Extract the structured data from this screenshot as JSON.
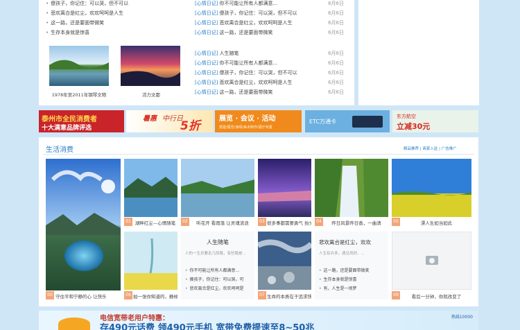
{
  "top_left_list": [
    "傻孩子，你记住：可以哭，但不可以",
    "悲欢离合是红尘，欢欢呵呵是人生",
    "这一路，还是要面带微笑",
    "生存本身就是惊喜"
  ],
  "top_thumbs": [
    {
      "caption": "1978年至2011年钢琴文物"
    },
    {
      "caption": "活力文都"
    }
  ],
  "news": [
    {
      "cat": "[心情日记]",
      "title": "你不可能让所有人都满意...",
      "date": "6月6日"
    },
    {
      "cat": "[心情日记]",
      "title": "傻孩子，你记住：可以哭，但不可以",
      "date": "6月6日"
    },
    {
      "cat": "[心情日记]",
      "title": "悲欢离合是红尘，欢欢呵呵是人生",
      "date": "6月6日"
    },
    {
      "cat": "[心情日记]",
      "title": "这一路，还是要面带微笑",
      "date": "6月6日"
    },
    {
      "cat": "[心情日记]",
      "title": "人生随笔",
      "date": "6月6日"
    },
    {
      "cat": "[心情日记]",
      "title": "你不可能让所有人都满意...",
      "date": "6月6日"
    },
    {
      "cat": "[心情日记]",
      "title": "傻孩子，你记住：可以哭，但不可以",
      "date": "6月6日"
    },
    {
      "cat": "[心情日记]",
      "title": "悲欢离合是红尘，欢欢呵呵是人生",
      "date": "6月6日"
    },
    {
      "cat": "[心情日记]",
      "title": "这一路，还是要面带微笑",
      "date": "6月6日"
    }
  ],
  "banners": {
    "b1": {
      "line1": "泰州市全民消费者",
      "line2": "十大满意品牌评选"
    },
    "b2": {
      "a": "暑惠",
      "b": "中行日",
      "c": "5折"
    },
    "b3": {
      "title": "展览 · 会议 · 活动",
      "sub": "搭建/展览/演绎/美术制作/展厅布置"
    },
    "b4": {
      "text": "ETC万通卡"
    },
    "b5": {
      "brand": "东方航空",
      "line": "立减30元"
    }
  },
  "life": {
    "title": "生活消费",
    "links": [
      "精品推荐",
      "商家入驻",
      "广告推广"
    ],
    "row1": [
      {
        "tag": "01",
        "caption": "湖畔红尘—心情随笔"
      },
      {
        "tag": "02",
        "caption": "听花开 看雨落 让灵魂流浪"
      },
      {
        "tag": "03",
        "caption": "很多事都需要勇气 抬头看看"
      },
      {
        "tag": "04",
        "caption": "昨日风景昨日香，一曲清"
      },
      {
        "tag": "05",
        "caption": "漂人生如当如此"
      }
    ],
    "row2": [
      {
        "tag": "06",
        "caption": "守住平和宁静的心 让快乐"
      },
      {
        "tag": "07",
        "caption": "拍一张你知道的，静候岁"
      },
      {
        "tag": "08",
        "caption": "生命的本质在于追求快乐"
      },
      {
        "tag": "09",
        "caption": "看后一分钟，你就改变了"
      }
    ],
    "card1": {
      "title": "人生随笔",
      "desc": "人的一生总要走几段路，有些路是...",
      "list": [
        "你不可能让所有人都满意...",
        "傻孩子，你记住：可以哭，可",
        "悲欢离合是红尘，欢欢呵呵是"
      ]
    },
    "card2": {
      "title": "悲欢离合是红尘，欢欢",
      "desc": "人生有许多，遇见尚好。...",
      "list": [
        "这一路，还是要面带微笑",
        "生存本身就是惊喜",
        "有，人生是一场梦"
      ]
    }
  },
  "bottom_banner": {
    "title": "电信宽带老用户特惠：",
    "line": "存490元话费  领490元手机   宽带免费提速至8~50兆",
    "hotline": "热线10000"
  }
}
